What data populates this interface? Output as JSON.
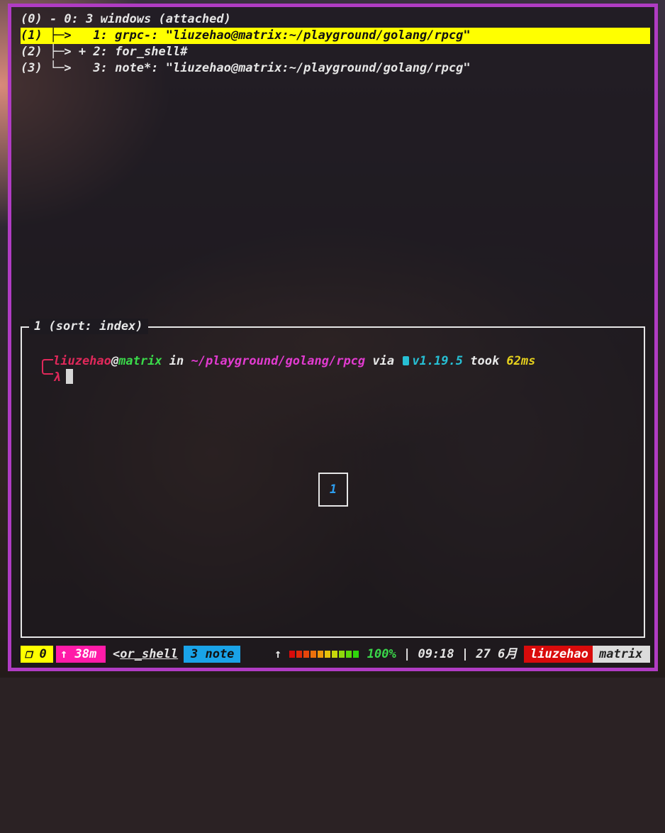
{
  "tree": {
    "session_line": "(0) - 0: 3 windows (attached)",
    "rows": [
      {
        "index": "(1)",
        "branch": " ├─>   ",
        "text": "1: grpc-: \"liuzehao@matrix:~/playground/golang/rpcg\""
      },
      {
        "index": "(2)",
        "branch": " ├─> + ",
        "text": "2: for_shell#"
      },
      {
        "index": "(3)",
        "branch": " └─>   ",
        "text": "3: note*: \"liuzehao@matrix:~/playground/golang/rpcg\""
      }
    ]
  },
  "pane": {
    "title": "1 (sort: index)",
    "prompt": {
      "user": "liuzehao",
      "at": "@",
      "host": "matrix",
      "in": " in ",
      "path": "~/playground/golang/rpcg",
      "via": " via ",
      "version": "v1.19.5",
      "took": " took ",
      "duration": "62ms",
      "symbol": "λ"
    },
    "index_label": "1"
  },
  "status_bar": {
    "session_icon": "❐",
    "session": "0",
    "uptime_arrow": "↑",
    "uptime": "38m",
    "current_window_prefix": "<",
    "current_window": "or_shell",
    "other_window": "3 note",
    "battery_arrow": "↑",
    "battery_percent": "100%",
    "battery_level": 1.0,
    "separator": "|",
    "time": "09:18",
    "date": "27 6月",
    "user": "liuzehao",
    "host": "matrix"
  },
  "colors": {
    "border": "#b03cc3",
    "selection": "#ffff00",
    "prompt_user": "#e0285a",
    "prompt_host": "#3ad94a",
    "prompt_path": "#e23bd0",
    "go_version": "#27bfd4",
    "duration": "#e6d11d"
  },
  "icons": {
    "go_icon": "go-gopher-icon",
    "session_icon": "session-box-icon"
  }
}
